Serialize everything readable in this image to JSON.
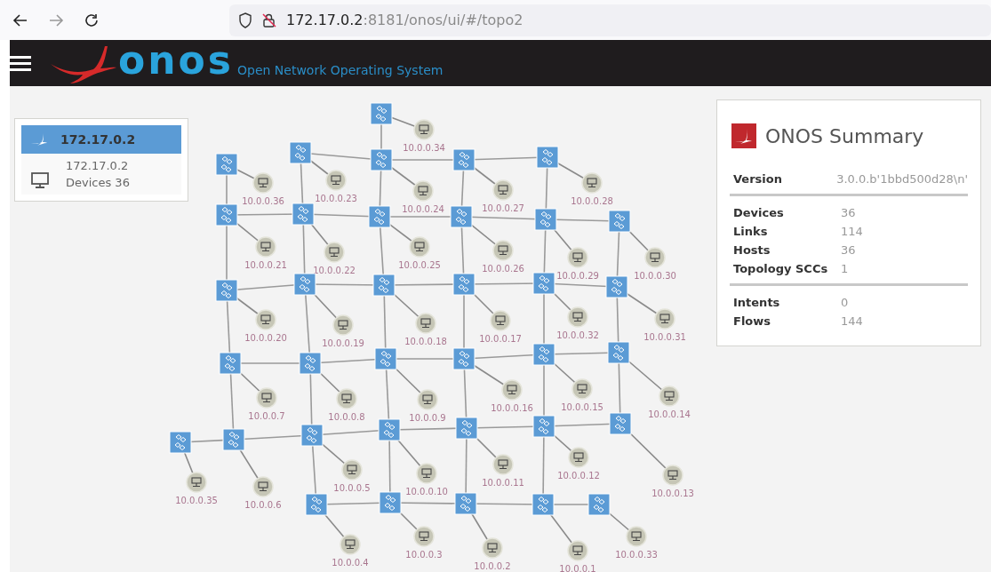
{
  "browser": {
    "url_host": "172.17.0.2",
    "url_path": ":8181/onos/ui/#/topo2"
  },
  "header": {
    "brand": "onos",
    "tagline": "Open Network Operating System"
  },
  "cluster_panel": {
    "items": [
      {
        "kind": "cluster",
        "label": "172.17.0.2",
        "selected": true
      },
      {
        "kind": "region",
        "label": "172.17.0.2",
        "detail": "Devices 36",
        "selected": false
      }
    ]
  },
  "summary": {
    "title": "ONOS Summary",
    "sections": [
      [
        {
          "label": "Version",
          "value": "3.0.0.b'1bbd500d28\\n'"
        }
      ],
      [
        {
          "label": "Devices",
          "value": "36"
        },
        {
          "label": "Links",
          "value": "114"
        },
        {
          "label": "Hosts",
          "value": "36"
        },
        {
          "label": "Topology SCCs",
          "value": "1"
        }
      ],
      [
        {
          "label": "Intents",
          "value": "0"
        },
        {
          "label": "Flows",
          "value": "144"
        }
      ]
    ]
  },
  "topology": {
    "switches": [
      {
        "host": "10.0.0.34"
      },
      {
        "host": "10.0.0.36"
      },
      {
        "host": "10.0.0.23"
      },
      {
        "host": "10.0.0.24"
      },
      {
        "host": "10.0.0.27"
      },
      {
        "host": "10.0.0.28"
      },
      {
        "host": "10.0.0.21"
      },
      {
        "host": "10.0.0.22"
      },
      {
        "host": "10.0.0.25"
      },
      {
        "host": "10.0.0.26"
      },
      {
        "host": "10.0.0.29"
      },
      {
        "host": "10.0.0.30"
      },
      {
        "host": "10.0.0.20"
      },
      {
        "host": "10.0.0.19"
      },
      {
        "host": "10.0.0.18"
      },
      {
        "host": "10.0.0.17"
      },
      {
        "host": "10.0.0.32"
      },
      {
        "host": "10.0.0.31"
      },
      {
        "host": "10.0.0.7"
      },
      {
        "host": "10.0.0.8"
      },
      {
        "host": "10.0.0.9"
      },
      {
        "host": "10.0.0.16"
      },
      {
        "host": "10.0.0.15"
      },
      {
        "host": "10.0.0.14"
      },
      {
        "host": "10.0.0.35"
      },
      {
        "host": "10.0.0.6"
      },
      {
        "host": "10.0.0.5"
      },
      {
        "host": "10.0.0.10"
      },
      {
        "host": "10.0.0.11"
      },
      {
        "host": "10.0.0.12"
      },
      {
        "host": "10.0.0.13"
      },
      {
        "host": "10.0.0.4"
      },
      {
        "host": "10.0.0.3"
      },
      {
        "host": "10.0.0.2"
      },
      {
        "host": "10.0.0.1"
      },
      {
        "host": "10.0.0.33"
      }
    ]
  }
}
